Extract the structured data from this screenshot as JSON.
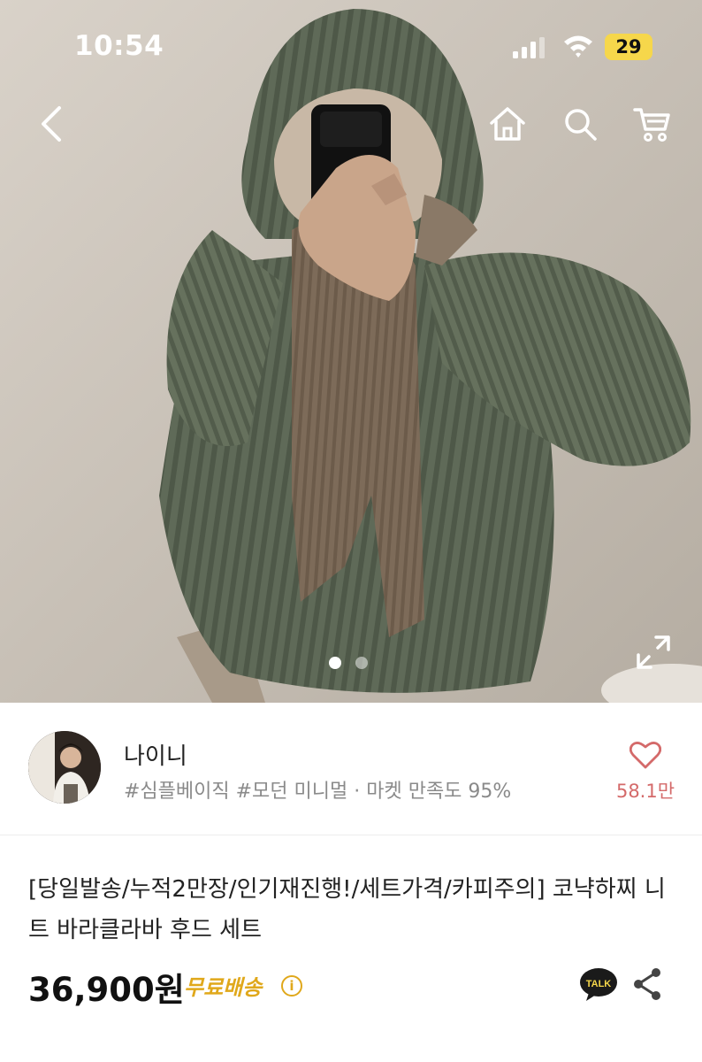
{
  "status_bar": {
    "time": "10:54",
    "battery": "29"
  },
  "gallery": {
    "dots": 2,
    "active_index": 0
  },
  "seller": {
    "name": "나이니",
    "tags": "#심플베이직 #모던 미니멀 · 마켓 만족도 95%",
    "likes": "58.1만"
  },
  "product": {
    "title": "[당일발송/누적2만장/인기재진행!/세트가격/카피주의] 코냑하찌 니트 바라클라바 후드 세트",
    "price": "36,900원",
    "shipping": "무료배송",
    "info_glyph": "i",
    "talk_label": "TALK"
  },
  "colors": {
    "accent": "#e0a81b",
    "like": "#d46a6a",
    "battery": "#f6d74b"
  },
  "icons": [
    "back-icon",
    "home-icon",
    "search-icon",
    "cart-icon",
    "expand-icon",
    "heart-icon",
    "info-icon",
    "kakao-talk-icon",
    "share-icon"
  ]
}
